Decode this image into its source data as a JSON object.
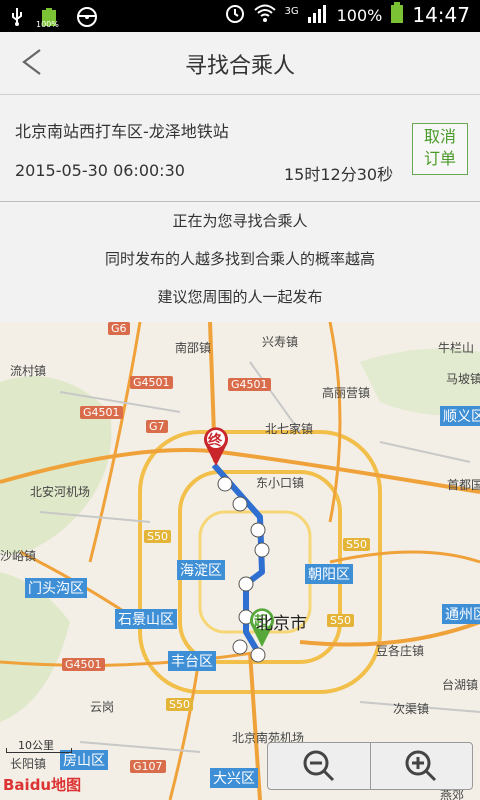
{
  "status_bar": {
    "battery_small": "100%",
    "network": "3G",
    "battery_percent": "100%",
    "time": "14:47"
  },
  "header": {
    "title": "寻找合乘人"
  },
  "trip": {
    "route": "北京南站西打车区-龙泽地铁站",
    "datetime": "2015-05-30 06:00:30",
    "duration": "15时12分30秒",
    "cancel_label": "取消\n订单"
  },
  "messages": [
    "正在为您寻找合乘人",
    "同时发布的人越多找到合乘人的概率越高",
    "建议您周围的人一起发布"
  ],
  "map": {
    "end_marker": "终",
    "start_marker": "起",
    "scale_label": "10公里",
    "logo": "Baidu地图",
    "place_labels": [
      "南邵镇",
      "兴寿镇",
      "牛栏山",
      "流村镇",
      "马坡镇",
      "高丽营镇",
      "顺义区",
      "北七家镇",
      "首都国",
      "东小口镇",
      "北安河机场",
      "海淀区",
      "朝阳区",
      "沙峪镇",
      "门头沟区",
      "石景山区",
      "北京市",
      "通州区",
      "丰台区",
      "豆各庄镇",
      "台湖镇",
      "云岗",
      "北京南苑机场",
      "房山区",
      "大兴区",
      "次渠镇",
      "长阳镇",
      "燕郊"
    ],
    "highways": [
      "G6",
      "G4501",
      "G4501",
      "G4501",
      "G7",
      "S50",
      "S50",
      "S50",
      "G4501",
      "S50",
      "G107"
    ]
  },
  "zoom": {
    "out_icon": "zoom-out-icon",
    "in_icon": "zoom-in-icon"
  }
}
